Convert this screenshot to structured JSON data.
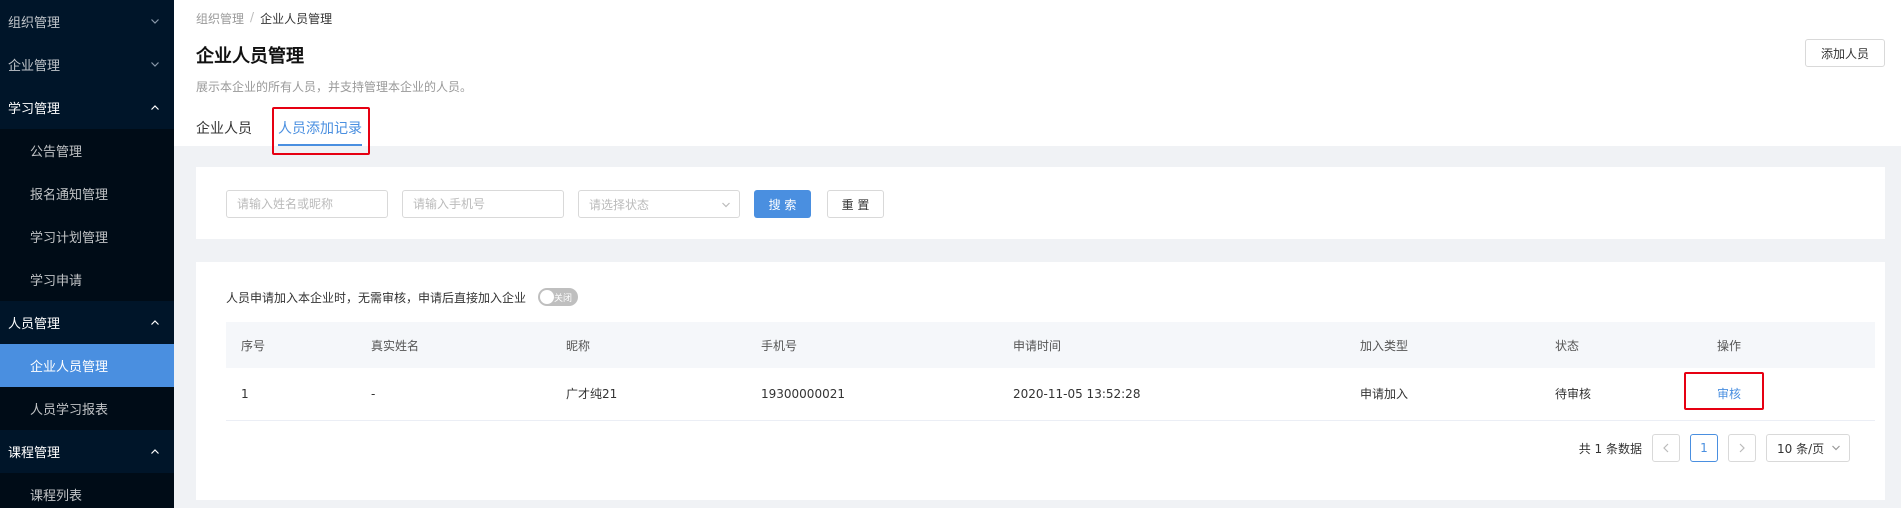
{
  "sidebar": {
    "items": [
      {
        "label": "组织管理",
        "type": "group",
        "arrow": "down"
      },
      {
        "label": "企业管理",
        "type": "group",
        "arrow": "down"
      },
      {
        "label": "学习管理",
        "type": "group-open",
        "arrow": "up"
      },
      {
        "label": "公告管理",
        "type": "sub"
      },
      {
        "label": "报名通知管理",
        "type": "sub"
      },
      {
        "label": "学习计划管理",
        "type": "sub"
      },
      {
        "label": "学习申请",
        "type": "sub"
      },
      {
        "label": "人员管理",
        "type": "group-open",
        "arrow": "up"
      },
      {
        "label": "企业人员管理",
        "type": "sub-active"
      },
      {
        "label": "人员学习报表",
        "type": "sub"
      },
      {
        "label": "课程管理",
        "type": "group-open",
        "arrow": "up"
      },
      {
        "label": "课程列表",
        "type": "sub"
      }
    ]
  },
  "breadcrumb": {
    "parent": "组织管理",
    "separator": "/",
    "current": "企业人员管理"
  },
  "page": {
    "title": "企业人员管理",
    "description": "展示本企业的所有人员，并支持管理本企业的人员。",
    "add_button": "添加人员"
  },
  "tabs": [
    {
      "label": "企业人员",
      "active": false
    },
    {
      "label": "人员添加记录",
      "active": true
    }
  ],
  "search": {
    "name_placeholder": "请输入姓名或昵称",
    "phone_placeholder": "请输入手机号",
    "status_placeholder": "请选择状态",
    "search_button": "搜 索",
    "reset_button": "重 置"
  },
  "notice": {
    "text": "人员申请加入本企业时，无需审核，申请后直接加入企业",
    "switch_label": "关闭",
    "switch_on": false
  },
  "table": {
    "headers": [
      "序号",
      "真实姓名",
      "昵称",
      "手机号",
      "申请时间",
      "加入类型",
      "状态",
      "操作"
    ],
    "rows": [
      {
        "index": "1",
        "real_name": "-",
        "nickname": "广才纯21",
        "phone": "19300000021",
        "apply_time": "2020-11-05 13:52:28",
        "join_type": "申请加入",
        "status": "待审核",
        "action": "审核"
      }
    ]
  },
  "pagination": {
    "total_text": "共 1 条数据",
    "current_page": "1",
    "page_size": "10 条/页"
  },
  "colors": {
    "sidebar_bg": "#001529",
    "accent": "#4a8fe0",
    "highlight_box": "#e60012"
  }
}
